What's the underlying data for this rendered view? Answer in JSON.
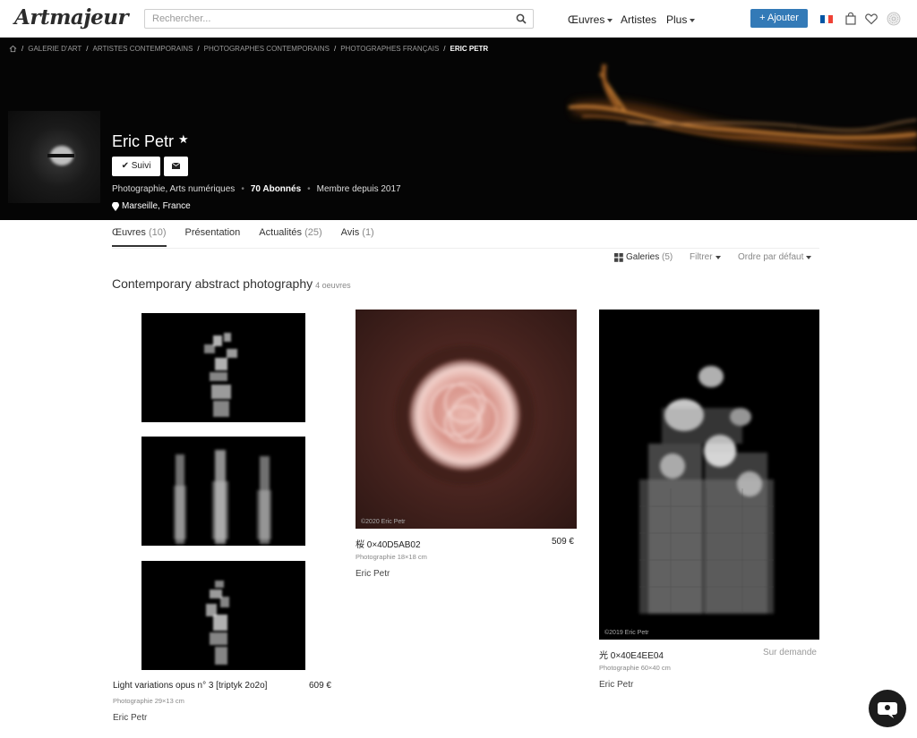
{
  "header": {
    "logo": "Artmajeur",
    "search_placeholder": "Rechercher...",
    "nav": {
      "works": "Œuvres",
      "artists": "Artistes",
      "more": "Plus"
    },
    "add_button": "+ Ajouter"
  },
  "breadcrumb": [
    "GALERIE D'ART",
    "ARTISTES CONTEMPORAINS",
    "PHOTOGRAPHES CONTEMPORAINS",
    "PHOTOGRAPHES FRANÇAIS",
    "ERIC PETR"
  ],
  "profile": {
    "name": "Eric Petr",
    "star": "★",
    "follow_label": "Suivi",
    "disciplines": "Photographie, Arts numériques",
    "followers": "70 Abonnés",
    "member_since": "Membre depuis 2017",
    "location": "Marseille, France"
  },
  "tabs": [
    {
      "label": "Œuvres",
      "count": "(10)"
    },
    {
      "label": "Présentation",
      "count": ""
    },
    {
      "label": "Actualités",
      "count": "(25)"
    },
    {
      "label": "Avis",
      "count": "(1)"
    }
  ],
  "toolbar": {
    "galleries": "Galeries",
    "galleries_count": "(5)",
    "filter": "Filtrer",
    "sort": "Ordre par défaut"
  },
  "section": {
    "title": "Contemporary abstract photography",
    "subtitle": "4 oeuvres"
  },
  "artworks": [
    {
      "title": "Light variations opus n° 3 [triptyk 2o2o]",
      "price": "609 €",
      "meta": "Photographie 29×13 cm",
      "artist": "Eric Petr",
      "watermark": ""
    },
    {
      "title": "桜 0×40D5AB02",
      "price": "509 €",
      "meta": "Photographie 18×18 cm",
      "artist": "Eric Petr",
      "watermark": "©2020 Eric Petr"
    },
    {
      "title": "光 0×40E4EE04",
      "price": "Sur demande",
      "meta": "Photographie 60×40 cm",
      "artist": "Eric Petr",
      "watermark": "©2019 Eric Petr"
    }
  ],
  "colors": {
    "accent": "#337ab7",
    "hero_bg": "#050505",
    "flag": [
      "#0055a4",
      "#ffffff",
      "#ef4135"
    ]
  }
}
